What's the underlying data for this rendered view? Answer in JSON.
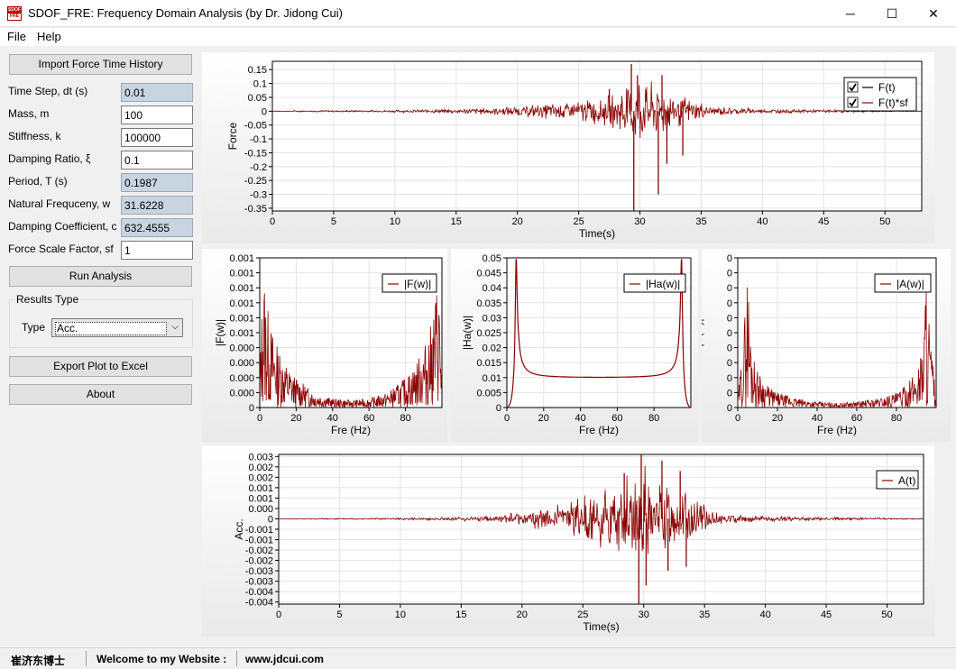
{
  "window": {
    "icon_text": "SDOF",
    "icon_text2": "FRE",
    "title": "SDOF_FRE: Frequency Domain Analysis (by Dr. Jidong Cui)",
    "minimize": "─",
    "maximize": "☐",
    "close": "✕"
  },
  "menu": {
    "file": "File",
    "help": "Help"
  },
  "left": {
    "import_button": "Import Force Time History",
    "params": [
      {
        "label": "Time Step, dt (s)",
        "value": "0.01",
        "readonly": true
      },
      {
        "label": "Mass, m",
        "value": "100",
        "readonly": false
      },
      {
        "label": "Stiffness, k",
        "value": "100000",
        "readonly": false
      },
      {
        "label": "Damping Ratio, ξ",
        "value": "0.1",
        "readonly": false
      },
      {
        "label": "Period, T (s)",
        "value": "0.1987",
        "readonly": true
      },
      {
        "label": "Natural Frequceny, w",
        "value": "31.6228",
        "readonly": true
      },
      {
        "label": "Damping Coefficient, c",
        "value": "632.4555",
        "readonly": true
      },
      {
        "label": "Force Scale Factor, sf",
        "value": "1",
        "readonly": false
      }
    ],
    "run_button": "Run Analysis",
    "results_group": "Results Type",
    "type_label": "Type",
    "type_value": "Acc.",
    "export_button": "Export Plot to Excel",
    "about_button": "About"
  },
  "status": {
    "name": "崔济东博士",
    "welcome": "Welcome to my Website :",
    "url": "www.jdcui.com"
  },
  "colors": {
    "series": "#8b0000",
    "plot_bg": "#ffffff",
    "grid": "#e4e4e4",
    "panel_gradient_end": "#e9e9e9"
  },
  "chart_data": [
    {
      "id": "force",
      "type": "line",
      "xlabel": "Time(s)",
      "ylabel": "Force",
      "xlim": [
        0,
        53
      ],
      "ylim": [
        -0.36,
        0.18
      ],
      "xticks": [
        0,
        5,
        10,
        15,
        20,
        25,
        30,
        35,
        40,
        45,
        50
      ],
      "yticks": [
        0.15,
        0.1,
        0.05,
        0,
        -0.05,
        -0.1,
        -0.15,
        -0.2,
        -0.25,
        -0.3,
        -0.35
      ],
      "ytick_labels": [
        "0.15",
        "0.1",
        "0.05",
        "0",
        "-0.05",
        "-0.1",
        "-0.15",
        "-0.2",
        "-0.25",
        "-0.3",
        "-0.35"
      ],
      "legend": {
        "position": "top-right",
        "entries": [
          "F(t)",
          "F(t)*sf"
        ],
        "checkboxes": true
      },
      "series": [
        {
          "name": "F(t)",
          "color": "#000000",
          "envelope": [
            [
              0,
              0.0
            ],
            [
              2,
              0.003
            ],
            [
              10,
              0.005
            ],
            [
              15,
              0.01
            ],
            [
              20,
              0.02
            ],
            [
              25,
              0.045
            ],
            [
              28,
              0.07
            ],
            [
              29.5,
              0.17
            ],
            [
              30.5,
              0.12
            ],
            [
              32,
              0.1
            ],
            [
              34,
              0.05
            ],
            [
              36,
              0.02
            ],
            [
              40,
              0.01
            ],
            [
              47,
              0.005
            ],
            [
              53,
              0
            ]
          ]
        },
        {
          "name": "F(t)*sf",
          "color": "#8b0000",
          "envelope": [
            [
              0,
              0.0
            ],
            [
              2,
              0.003
            ],
            [
              10,
              0.005
            ],
            [
              15,
              0.01
            ],
            [
              20,
              0.02
            ],
            [
              25,
              0.045
            ],
            [
              28,
              0.07
            ],
            [
              29.5,
              0.17
            ],
            [
              30.5,
              0.12
            ],
            [
              32,
              0.1
            ],
            [
              34,
              0.05
            ],
            [
              36,
              0.02
            ],
            [
              40,
              0.01
            ],
            [
              47,
              0.005
            ],
            [
              53,
              0
            ]
          ]
        }
      ],
      "spikes": [
        [
          29.3,
          0.17
        ],
        [
          29.5,
          -0.36
        ],
        [
          29.8,
          0.13
        ],
        [
          31.5,
          -0.3
        ],
        [
          31.8,
          0.13
        ],
        [
          32.2,
          -0.19
        ],
        [
          33.5,
          -0.16
        ],
        [
          27.5,
          0.08
        ]
      ]
    },
    {
      "id": "fw",
      "type": "line",
      "xlabel": "Fre (Hz)",
      "ylabel": "|F(w)|",
      "xlim": [
        0,
        100
      ],
      "ylim": [
        0,
        0.001
      ],
      "xticks": [
        0,
        20,
        40,
        60,
        80
      ],
      "yticks": [
        0.001,
        0.0009,
        0.0008,
        0.0007,
        0.0006,
        0.0005,
        0.0004,
        0.0003,
        0.0002,
        0.0001,
        0
      ],
      "ytick_labels": [
        "0.001",
        "0.001",
        "0.001",
        "0.001",
        "0.001",
        "0.001",
        "0.000",
        "0.000",
        "0.000",
        "0.000",
        "0"
      ],
      "legend": {
        "position": "top-right",
        "entries": [
          "|F(w)|"
        ]
      },
      "envelope": [
        [
          0,
          0.25
        ],
        [
          2,
          0.95
        ],
        [
          4,
          0.7
        ],
        [
          6,
          0.55
        ],
        [
          10,
          0.4
        ],
        [
          15,
          0.28
        ],
        [
          20,
          0.2
        ],
        [
          30,
          0.1
        ],
        [
          40,
          0.06
        ],
        [
          50,
          0.05
        ],
        [
          60,
          0.06
        ],
        [
          70,
          0.1
        ],
        [
          80,
          0.2
        ],
        [
          85,
          0.28
        ],
        [
          90,
          0.4
        ],
        [
          94,
          0.55
        ],
        [
          96,
          0.7
        ],
        [
          98,
          0.95
        ],
        [
          100,
          0.25
        ]
      ]
    },
    {
      "id": "haw",
      "type": "line",
      "xlabel": "Fre (Hz)",
      "ylabel": "|Ha(w)|",
      "xlim": [
        0,
        100
      ],
      "ylim": [
        0,
        0.05
      ],
      "xticks": [
        0,
        20,
        40,
        60,
        80
      ],
      "yticks": [
        0.05,
        0.045,
        0.04,
        0.035,
        0.03,
        0.025,
        0.02,
        0.015,
        0.01,
        0.005,
        0
      ],
      "ytick_labels": [
        "0.05",
        "0.045",
        "0.04",
        "0.035",
        "0.03",
        "0.025",
        "0.02",
        "0.015",
        "0.01",
        "0.005",
        "0"
      ],
      "legend": {
        "position": "top-right",
        "entries": [
          "|Ha(w)|"
        ]
      },
      "peak_freq": 5.03,
      "baseline": 0.01
    },
    {
      "id": "aw",
      "type": "line",
      "xlabel": "Fre (Hz)",
      "ylabel": "|A(w)|",
      "xlim": [
        0,
        100
      ],
      "ylim": [
        0,
        1
      ],
      "xticks": [
        0,
        20,
        40,
        60,
        80
      ],
      "yticks": [
        1,
        0.9,
        0.8,
        0.7,
        0.6,
        0.5,
        0.4,
        0.3,
        0.2,
        0.1,
        0
      ],
      "ytick_labels": [
        "0",
        "0",
        "0",
        "0",
        "0",
        "0",
        "0",
        "0",
        "0",
        "0",
        "0"
      ],
      "legend": {
        "position": "top-right",
        "entries": [
          "|A(w)|"
        ]
      },
      "envelope": [
        [
          0,
          0.05
        ],
        [
          3,
          0.5
        ],
        [
          5,
          1.0
        ],
        [
          6,
          0.6
        ],
        [
          8,
          0.35
        ],
        [
          10,
          0.25
        ],
        [
          15,
          0.15
        ],
        [
          20,
          0.1
        ],
        [
          30,
          0.06
        ],
        [
          40,
          0.04
        ],
        [
          50,
          0.03
        ],
        [
          60,
          0.04
        ],
        [
          70,
          0.06
        ],
        [
          80,
          0.1
        ],
        [
          85,
          0.15
        ],
        [
          90,
          0.25
        ],
        [
          92,
          0.35
        ],
        [
          94,
          0.6
        ],
        [
          95,
          1.0
        ],
        [
          97,
          0.5
        ],
        [
          100,
          0.05
        ]
      ]
    },
    {
      "id": "at",
      "type": "line",
      "xlabel": "Time(s)",
      "ylabel": "Acc.",
      "xlim": [
        0,
        53
      ],
      "ylim": [
        -0.0041,
        0.0031
      ],
      "xticks": [
        0,
        5,
        10,
        15,
        20,
        25,
        30,
        35,
        40,
        45,
        50
      ],
      "yticks": [
        0.003,
        0.0025,
        0.002,
        0.0015,
        0.001,
        0.0005,
        0,
        -0.0005,
        -0.001,
        -0.0015,
        -0.002,
        -0.0025,
        -0.003,
        -0.0035,
        -0.004
      ],
      "ytick_labels": [
        "0.003",
        "0.002",
        "0.002",
        "0.001",
        "0.001",
        "0.000",
        "0",
        "-0.001",
        "-0.001",
        "-0.002",
        "-0.002",
        "-0.003",
        "-0.003",
        "-0.004",
        "-0.004"
      ],
      "legend": {
        "position": "top-right",
        "entries": [
          "A(t)"
        ]
      },
      "envelope": [
        [
          0,
          0
        ],
        [
          2,
          3e-05
        ],
        [
          10,
          5e-05
        ],
        [
          14,
          0.0001
        ],
        [
          18,
          0.0002
        ],
        [
          20,
          0.0004
        ],
        [
          22,
          0.0006
        ],
        [
          24,
          0.001
        ],
        [
          25,
          0.0015
        ],
        [
          27,
          0.0018
        ],
        [
          29,
          0.0022
        ],
        [
          30,
          0.0028
        ],
        [
          31,
          0.002
        ],
        [
          32,
          0.0022
        ],
        [
          34,
          0.0012
        ],
        [
          36,
          0.0004
        ],
        [
          38,
          0.0002
        ],
        [
          40,
          0.00015
        ],
        [
          45,
          0.0001
        ],
        [
          53,
          3e-05
        ]
      ],
      "spikes": [
        [
          29.8,
          0.0031
        ],
        [
          29.6,
          -0.0041
        ],
        [
          30.2,
          -0.0032
        ],
        [
          31.5,
          0.0028
        ],
        [
          32.0,
          -0.0025
        ],
        [
          33.0,
          0.0023
        ],
        [
          33.5,
          -0.0023
        ],
        [
          28.4,
          0.0022
        ]
      ]
    }
  ]
}
